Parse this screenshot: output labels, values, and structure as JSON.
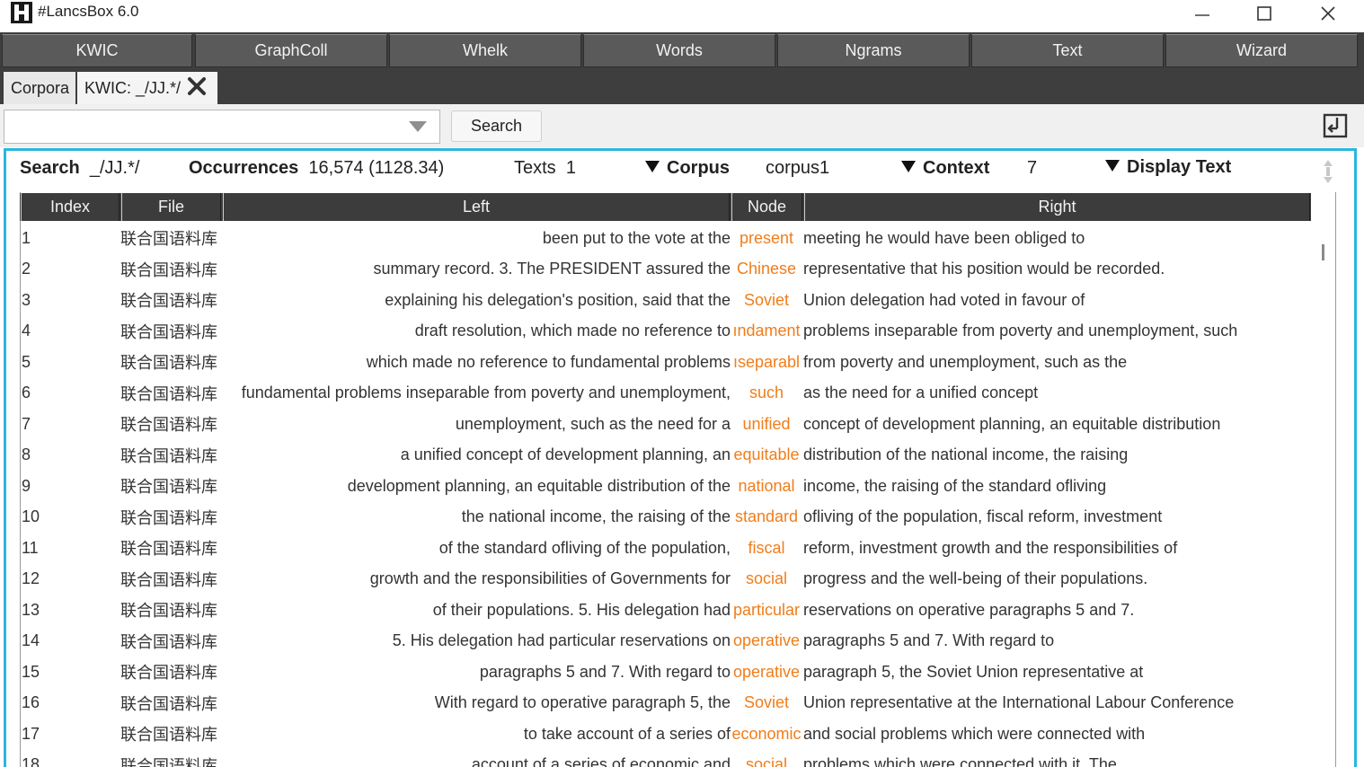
{
  "window": {
    "title": "#LancsBox 6.0",
    "icons": [
      "app-icon",
      "minimize-icon",
      "maximize-icon",
      "close-icon"
    ]
  },
  "main_tabs": [
    {
      "label": "KWIC"
    },
    {
      "label": "GraphColl"
    },
    {
      "label": "Whelk"
    },
    {
      "label": "Words"
    },
    {
      "label": "Ngrams"
    },
    {
      "label": "Text"
    },
    {
      "label": "Wizard"
    }
  ],
  "sub_tabs": {
    "corpora": "Corpora",
    "kwic": "KWIC: _/JJ.*/"
  },
  "search": {
    "value": "",
    "button_label": "Search"
  },
  "info": {
    "search_label": "Search",
    "search_value": "_/JJ.*/",
    "occurrences_label": "Occurrences",
    "occurrences_value": "16,574 (1128.34)",
    "texts_label": "Texts",
    "texts_value": "1",
    "corpus_label": "Corpus",
    "corpus_value": "corpus1",
    "context_label": "Context",
    "context_value": "7",
    "display_label": "Display Text"
  },
  "colors": {
    "accent_border": "#29b6e0",
    "node_text": "#f07d1a",
    "tab_bar": "#3e3e3e",
    "tab": "#5a5a5a"
  },
  "table": {
    "columns": [
      "Index",
      "File",
      "Left",
      "Node",
      "Right"
    ],
    "rows": [
      {
        "index": "1",
        "file": "联合国语料库",
        "left": "been put to the vote at the",
        "node": "present",
        "right": "meeting he would have been obliged to"
      },
      {
        "index": "2",
        "file": "联合国语料库",
        "left": "summary record. 3. The PRESIDENT assured the",
        "node": "Chinese",
        "right": "representative that his position would be recorded."
      },
      {
        "index": "3",
        "file": "联合国语料库",
        "left": "explaining his delegation's position, said that the",
        "node": "Soviet",
        "right": "Union delegation had voted in favour of"
      },
      {
        "index": "4",
        "file": "联合国语料库",
        "left": "draft resolution, which made no reference to",
        "node": "ındament",
        "right": "problems inseparable from poverty and unemployment, such"
      },
      {
        "index": "5",
        "file": "联合国语料库",
        "left": "which made no reference to fundamental problems",
        "node": "ıseparabl",
        "right": "from poverty and unemployment, such as the"
      },
      {
        "index": "6",
        "file": "联合国语料库",
        "left": "fundamental problems inseparable from poverty and unemployment,",
        "node": "such",
        "right": "as the need for a unified concept"
      },
      {
        "index": "7",
        "file": "联合国语料库",
        "left": "unemployment, such as the need for a",
        "node": "unified",
        "right": "concept of development planning, an equitable distribution"
      },
      {
        "index": "8",
        "file": "联合国语料库",
        "left": "a unified concept of development planning, an",
        "node": "equitable",
        "right": "distribution of the national income, the raising"
      },
      {
        "index": "9",
        "file": "联合国语料库",
        "left": "development planning, an equitable distribution of the",
        "node": "national",
        "right": "income, the raising of the standard ofliving"
      },
      {
        "index": "10",
        "file": "联合国语料库",
        "left": "the national income, the raising of the",
        "node": "standard",
        "right": "ofliving of the population, fiscal reform, investment"
      },
      {
        "index": "11",
        "file": "联合国语料库",
        "left": "of the standard ofliving of the population,",
        "node": "fiscal",
        "right": "reform, investment growth and the responsibilities of"
      },
      {
        "index": "12",
        "file": "联合国语料库",
        "left": "growth and the responsibilities of Governments for",
        "node": "social",
        "right": "progress and the well-being of their populations."
      },
      {
        "index": "13",
        "file": "联合国语料库",
        "left": "of their populations. 5. His delegation had",
        "node": "particular",
        "right": "reservations on operative paragraphs 5 and 7."
      },
      {
        "index": "14",
        "file": "联合国语料库",
        "left": "5. His delegation had particular reservations on",
        "node": "operative",
        "right": "paragraphs 5 and 7. With regard to"
      },
      {
        "index": "15",
        "file": "联合国语料库",
        "left": "paragraphs 5 and 7. With regard to",
        "node": "operative",
        "right": "paragraph 5, the Soviet Union representative at"
      },
      {
        "index": "16",
        "file": "联合国语料库",
        "left": "With regard to operative paragraph 5, the",
        "node": "Soviet",
        "right": "Union representative at the International Labour Conference"
      },
      {
        "index": "17",
        "file": "联合国语料库",
        "left": "to take account of a series of",
        "node": "economic",
        "right": "and social problems which were connected with"
      },
      {
        "index": "18",
        "file": "联合国语料库",
        "left": "account of a series of economic and",
        "node": "social",
        "right": "problems which were connected with it. The"
      }
    ]
  }
}
